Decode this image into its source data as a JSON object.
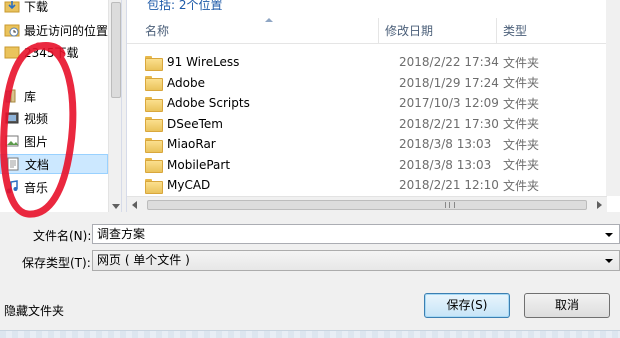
{
  "nav": {
    "items": [
      {
        "label": "下载",
        "icon": "download-folder-icon"
      },
      {
        "label": "最近访问的位置",
        "icon": "recent-places-icon"
      },
      {
        "label": "2345下载",
        "icon": "folder-icon"
      },
      {
        "label": "库",
        "icon": "libraries-icon"
      },
      {
        "label": "视频",
        "icon": "video-library-icon"
      },
      {
        "label": "图片",
        "icon": "pictures-library-icon"
      },
      {
        "label": "文档",
        "icon": "documents-library-icon"
      },
      {
        "label": "音乐",
        "icon": "music-library-icon"
      }
    ],
    "selected": "文档"
  },
  "file_list": {
    "includes_text": "包括: 2个位置",
    "columns": {
      "name": "名称",
      "date": "修改日期",
      "type": "类型"
    },
    "rows": [
      {
        "name": "91 WireLess",
        "date": "2018/2/22 17:34",
        "type": "文件夹"
      },
      {
        "name": "Adobe",
        "date": "2018/1/29 17:24",
        "type": "文件夹"
      },
      {
        "name": "Adobe Scripts",
        "date": "2017/10/3 12:09",
        "type": "文件夹"
      },
      {
        "name": "DSeeTem",
        "date": "2018/2/21 17:30",
        "type": "文件夹"
      },
      {
        "name": "MiaoRar",
        "date": "2018/3/8 13:03",
        "type": "文件夹"
      },
      {
        "name": "MobilePart",
        "date": "2018/3/8 13:03",
        "type": "文件夹"
      },
      {
        "name": "MyCAD",
        "date": "2018/2/21 12:10",
        "type": "文件夹"
      }
    ]
  },
  "form": {
    "filename_label": "文件名(N):",
    "filename_value": "调查方案",
    "filetype_label": "保存类型(T):",
    "filetype_value": "网页 ( 单个文件 )"
  },
  "footer": {
    "hide_folders": "隐藏文件夹",
    "save_label": "保存(S)",
    "cancel_label": "取消"
  },
  "colors": {
    "annotation": "#e8112a",
    "selection": "#cce8ff",
    "link": "#1e5aa8"
  }
}
